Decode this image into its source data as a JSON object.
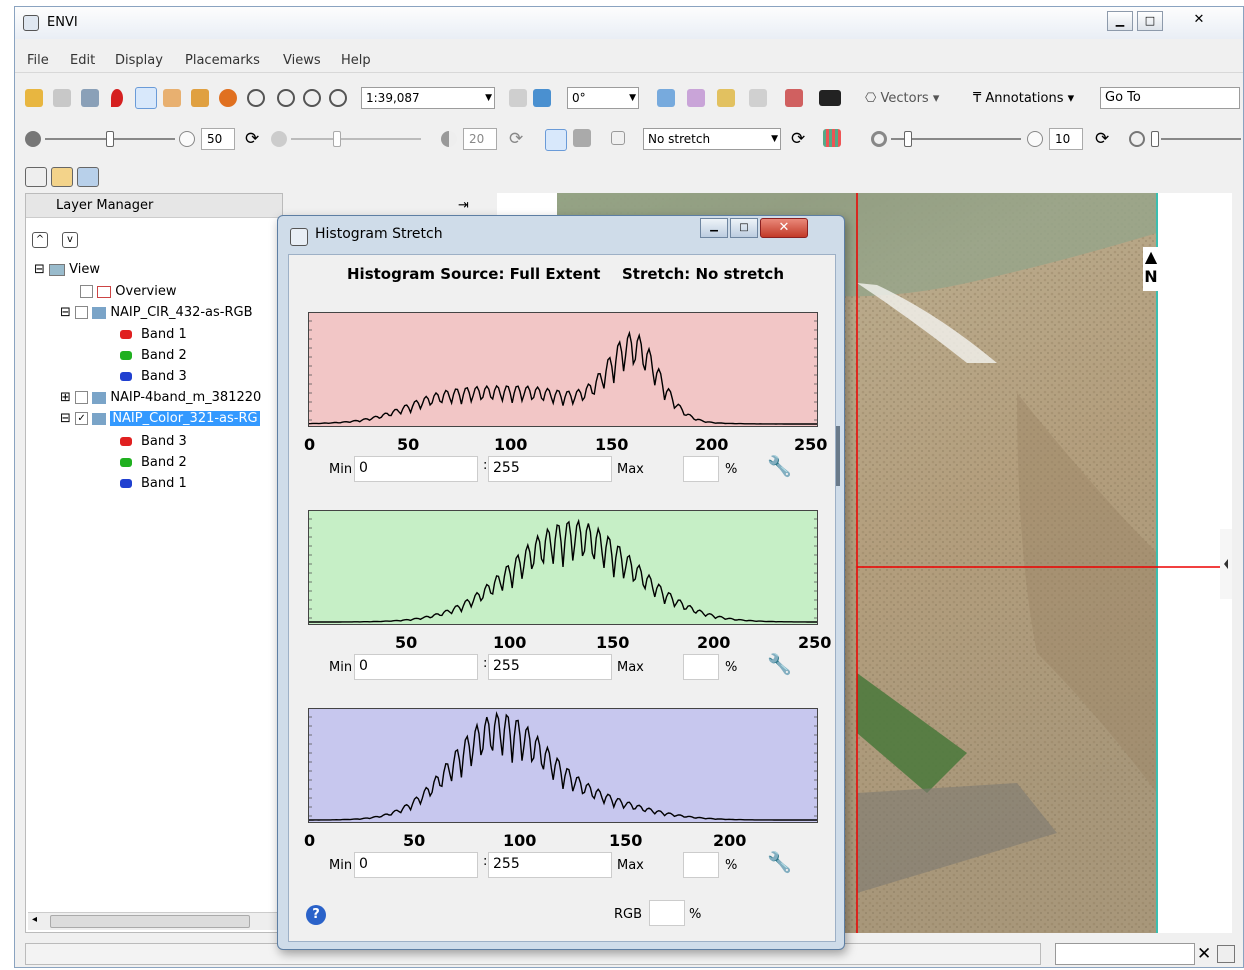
{
  "app": {
    "title": "ENVI"
  },
  "menu": [
    "File",
    "Edit",
    "Display",
    "Placemarks",
    "Views",
    "Help"
  ],
  "toolbar1": {
    "zoom_value": "1:39,087",
    "rotation_value": "0°",
    "vectors_label": "Vectors",
    "annotations_label": "Annotations",
    "goto_label": "Go To"
  },
  "toolbar2": {
    "brightness_value": "50",
    "contrast_value": "20",
    "stretch_value": "No stretch",
    "sharpen_value": "10"
  },
  "layer_manager": {
    "title": "Layer Manager",
    "tree": [
      {
        "label": "View",
        "checked": null,
        "swatch": null
      },
      {
        "label": "Overview",
        "checked": false,
        "swatch": null
      },
      {
        "label": "NAIP_CIR_432-as-RGB",
        "checked": false,
        "swatch": null
      },
      {
        "label": "Band 1",
        "checked": null,
        "swatch": "#e02020"
      },
      {
        "label": "Band 2",
        "checked": null,
        "swatch": "#20b020"
      },
      {
        "label": "Band 3",
        "checked": null,
        "swatch": "#2040d0"
      },
      {
        "label": "NAIP-4band_m_381220",
        "checked": false,
        "swatch": null
      },
      {
        "label": "NAIP_Color_321-as-RG",
        "checked": true,
        "swatch": null
      },
      {
        "label": "Band 3",
        "checked": null,
        "swatch": "#e02020"
      },
      {
        "label": "Band 2",
        "checked": null,
        "swatch": "#20b020"
      },
      {
        "label": "Band 1",
        "checked": null,
        "swatch": "#2040d0"
      }
    ]
  },
  "histogram_dialog": {
    "title": "Histogram Stretch",
    "source_label": "Histogram Source: Full Extent",
    "stretch_label": "Stretch: No stretch",
    "min_label": "Min",
    "max_label": "Max",
    "percent_label": "%",
    "colon": ":",
    "rgb_label": "RGB",
    "panels": [
      {
        "ticks": [
          "0",
          "50",
          "100",
          "150",
          "200",
          "250"
        ],
        "min_value": "0",
        "max_value": "255",
        "bg": "#f2c6c6"
      },
      {
        "ticks": [
          "50",
          "100",
          "150",
          "200",
          "250"
        ],
        "min_value": "0",
        "max_value": "255",
        "bg": "#c6efc6"
      },
      {
        "ticks": [
          "0",
          "50",
          "100",
          "150",
          "200"
        ],
        "min_value": "0",
        "max_value": "255",
        "bg": "#c7c7ee"
      }
    ]
  },
  "map": {
    "north_label": "N"
  },
  "statusbar": {
    "close_glyph": "✕"
  }
}
